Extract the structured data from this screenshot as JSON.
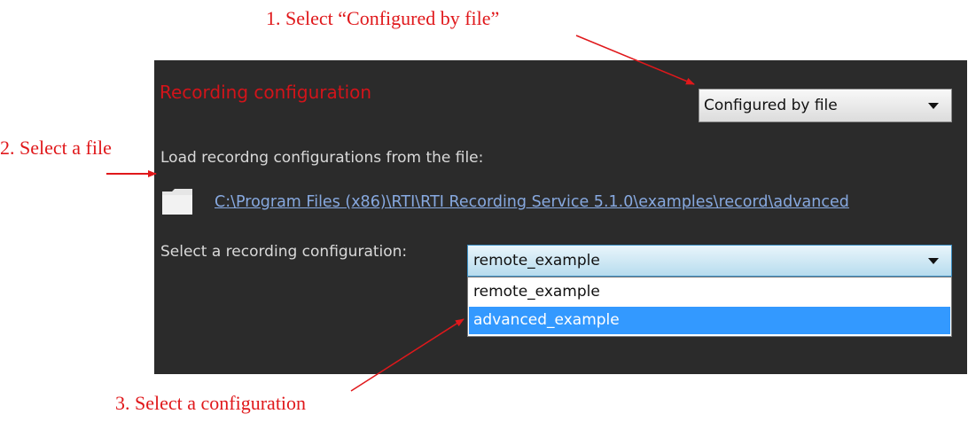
{
  "annotations": {
    "step1": "1. Select “Configured by file”",
    "step2": "2. Select a file",
    "step3": "3. Select a configuration",
    "color": "#e0181b"
  },
  "panel": {
    "title": "Recording configuration",
    "mode_select": {
      "value": "Configured by file",
      "icon": "chevron-down-icon"
    },
    "load_label": "Load recordng configurations from the file:",
    "folder_icon": "folder-icon",
    "file_path": "C:\\Program Files (x86)\\RTI\\RTI Recording Service 5.1.0\\examples\\record\\advanced",
    "config_label": "Select a recording configuration:",
    "config_select": {
      "value": "remote_example",
      "options": [
        "remote_example",
        "advanced_example"
      ],
      "highlighted": "advanced_example"
    }
  },
  "colors": {
    "panel_background": "#2b2b2b",
    "title": "#d2141a",
    "link": "#87a9e0",
    "highlight": "#3399ff"
  }
}
